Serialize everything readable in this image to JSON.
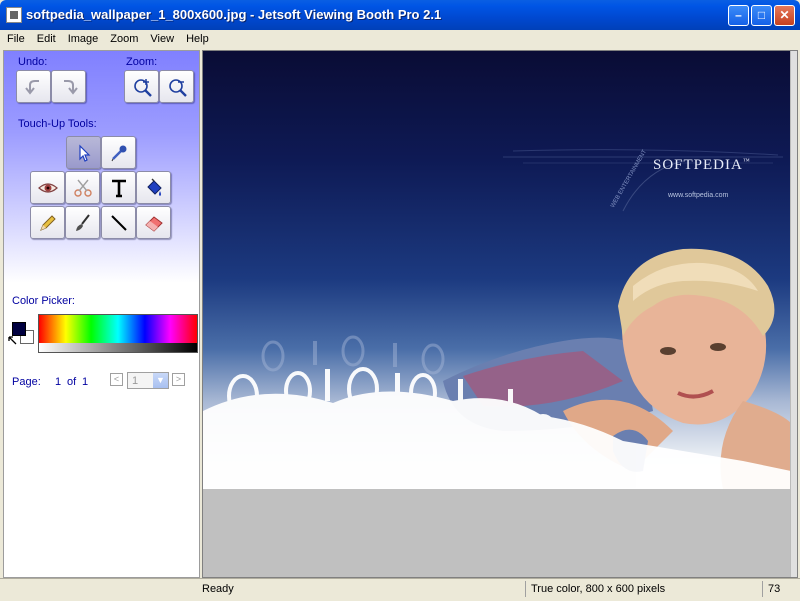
{
  "window": {
    "title": "softpedia_wallpaper_1_800x600.jpg - Jetsoft Viewing Booth Pro 2.1"
  },
  "menu": [
    "File",
    "Edit",
    "Image",
    "Zoom",
    "View",
    "Help"
  ],
  "panel": {
    "undo_label": "Undo:",
    "zoom_label": "Zoom:",
    "touchup_label": "Touch-Up Tools:",
    "color_picker_label": "Color Picker:",
    "colors": {
      "foreground": "#000040",
      "background": "#FFFFFF"
    },
    "page_label": "Page:",
    "page_current": "1",
    "page_of": "of",
    "page_total": "1",
    "page_select_value": "1"
  },
  "image": {
    "brand_text": "SOFTPEDIA",
    "brand_tm": "™",
    "url_text": "www.softpedia.com",
    "web_text": "WEB ENTERTAINMENT"
  },
  "status": {
    "ready": "Ready",
    "color_info": "True color, 800 x 600 pixels",
    "zoom": "73"
  }
}
